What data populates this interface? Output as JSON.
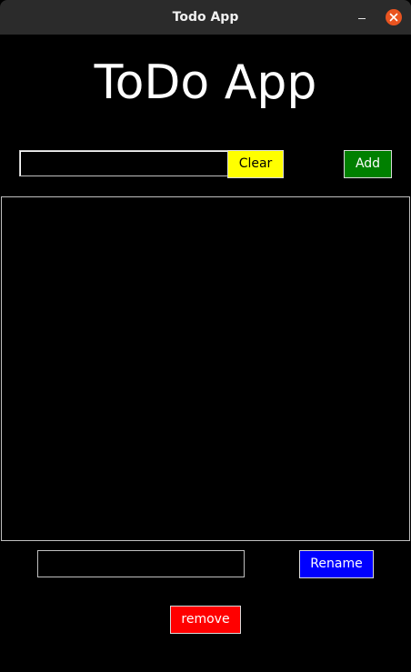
{
  "window": {
    "title": "Todo App"
  },
  "titlebar_icons": {
    "minimize": "minimize-icon",
    "close": "close-icon"
  },
  "main": {
    "heading": "ToDo App",
    "todo_input": {
      "value": "",
      "placeholder": ""
    },
    "clear_label": "Clear",
    "add_label": "Add",
    "todo_items": [],
    "rename_input": {
      "value": "",
      "placeholder": ""
    },
    "rename_label": "Rename",
    "remove_label": "remove"
  },
  "colors": {
    "background": "#000000",
    "titlebar": "#2b2b2b",
    "close_button": "#e95420",
    "clear_button": "#ffff00",
    "add_button": "#008000",
    "rename_button": "#0000ff",
    "remove_button": "#ff0000"
  }
}
